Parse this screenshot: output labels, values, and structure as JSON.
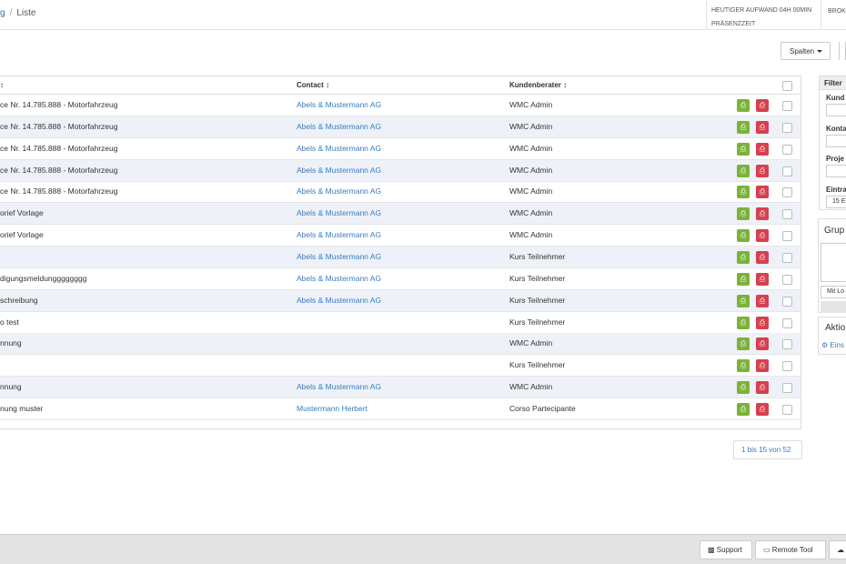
{
  "breadcrumb": {
    "prev": "g",
    "current": "Liste"
  },
  "header": {
    "effort": "HEUTIGER AUFWAND 04H 00MIN",
    "presence": "PRÄSENZZEIT",
    "user": "BROK"
  },
  "toolbar": {
    "columns_label": "Spalten"
  },
  "table": {
    "columns": [
      "↕",
      "Contact ↕",
      "Kundenberater ↕"
    ],
    "rows": [
      {
        "title": "ce Nr. 14.785.888 - Motorfahrzeug",
        "contact": "Abels & Mustermann AG",
        "advisor": "WMC Admin"
      },
      {
        "title": "ce Nr. 14.785.888 - Motorfahrzeug",
        "contact": "Abels & Mustermann AG",
        "advisor": "WMC Admin"
      },
      {
        "title": "ce Nr. 14.785.888 - Motorfahrzeug",
        "contact": "Abels & Mustermann AG",
        "advisor": "WMC Admin"
      },
      {
        "title": "ce Nr. 14.785.888 - Motorfahrzeug",
        "contact": "Abels & Mustermann AG",
        "advisor": "WMC Admin"
      },
      {
        "title": "ce Nr. 14.785.888 - Motorfahrzeug",
        "contact": "Abels & Mustermann AG",
        "advisor": "WMC Admin"
      },
      {
        "title": "orief Vorlage",
        "contact": "Abels & Mustermann AG",
        "advisor": "WMC Admin"
      },
      {
        "title": "orief Vorlage",
        "contact": "Abels & Mustermann AG",
        "advisor": "WMC Admin"
      },
      {
        "title": "",
        "contact": "Abels & Mustermann AG",
        "advisor": "Kurs Teilnehmer"
      },
      {
        "title": "digungsmeldungggggggg",
        "contact": "Abels & Mustermann AG",
        "advisor": "Kurs Teilnehmer"
      },
      {
        "title": "schreibung",
        "contact": "Abels & Mustermann AG",
        "advisor": "Kurs Teilnehmer"
      },
      {
        "title": "o test",
        "contact": "",
        "advisor": "Kurs Teilnehmer"
      },
      {
        "title": "nnung",
        "contact": "",
        "advisor": "WMC Admin"
      },
      {
        "title": "",
        "contact": "",
        "advisor": "Kurs Teilnehmer"
      },
      {
        "title": "nnung",
        "contact": "Abels & Mustermann AG",
        "advisor": "WMC Admin"
      },
      {
        "title": "nung muster",
        "contact": "Mustermann Herbert",
        "advisor": "Corso Partecipante"
      }
    ]
  },
  "pager": "1 bis 15 von 52",
  "filter": {
    "title": "Filter",
    "fields": [
      "Kund",
      "Konta",
      "Proje",
      "Eintra"
    ],
    "entries_value": "15 E"
  },
  "grouping": {
    "title": "Grup",
    "option": "Mit Lo"
  },
  "actions": {
    "title": "Aktio",
    "settings_link": "Eins"
  },
  "footer": {
    "support": "Support",
    "remote": "Remote Tool"
  },
  "colors": {
    "link": "#3a7bbf",
    "pdf_green": "#7bb23a",
    "pdf_red": "#d6404f",
    "row_alt": "#eef2f8"
  }
}
